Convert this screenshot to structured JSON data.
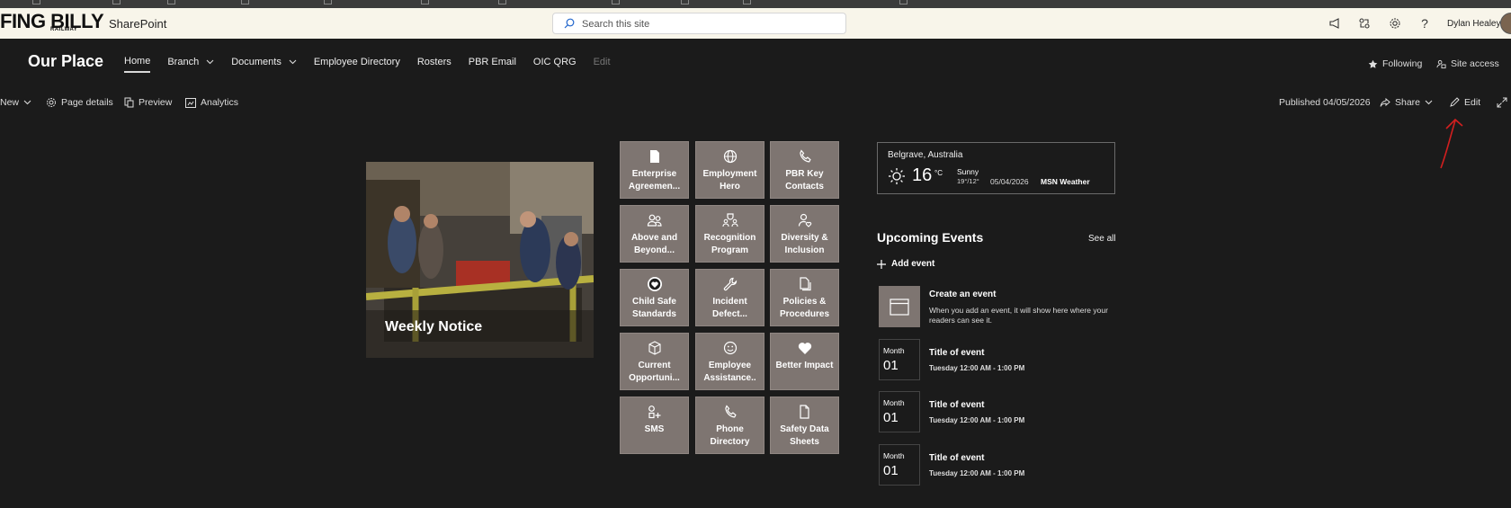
{
  "suitebar": {
    "logo_text": "FING BILLY",
    "logo_subtext": "RAILWAY",
    "app_name": "SharePoint",
    "search_placeholder": "Search this site",
    "icons": [
      "megaphone-icon",
      "share-app-icon",
      "settings-icon",
      "help-icon"
    ],
    "user_name": "Dylan Healey"
  },
  "site": {
    "title": "Our Place",
    "nav": [
      {
        "label": "Home",
        "active": true
      },
      {
        "label": "Branch",
        "dropdown": true
      },
      {
        "label": "Documents",
        "dropdown": true
      },
      {
        "label": "Employee Directory"
      },
      {
        "label": "Rosters"
      },
      {
        "label": "PBR Email"
      },
      {
        "label": "OIC QRG"
      },
      {
        "label": "Edit",
        "muted": true
      }
    ],
    "following_label": "Following",
    "site_access_label": "Site access"
  },
  "commandbar": {
    "new_label": "New",
    "page_details_label": "Page details",
    "preview_label": "Preview",
    "analytics_label": "Analytics",
    "published_label": "Published 04/05/2026",
    "share_label": "Share",
    "edit_label": "Edit"
  },
  "hero": {
    "title": "Weekly Notice"
  },
  "quick_links": [
    {
      "label": "Enterprise Agreemen...",
      "icon": "document-icon"
    },
    {
      "label": "Employment Hero",
      "icon": "globe-icon"
    },
    {
      "label": "PBR Key Contacts",
      "icon": "phone-icon"
    },
    {
      "label": "Above and Beyond...",
      "icon": "people-icon"
    },
    {
      "label": "Recognition Program",
      "icon": "trophy-people-icon"
    },
    {
      "label": "Diversity & Inclusion",
      "icon": "person-heart-icon"
    },
    {
      "label": "Child Safe Standards",
      "icon": "child-safe-badge-icon"
    },
    {
      "label": "Incident Defect...",
      "icon": "wrench-icon"
    },
    {
      "label": "Policies & Procedures",
      "icon": "documents-icon"
    },
    {
      "label": "Current Opportuni...",
      "icon": "cube-icon"
    },
    {
      "label": "Employee Assistance..",
      "icon": "smiley-icon"
    },
    {
      "label": "Better Impact",
      "icon": "heart-icon"
    },
    {
      "label": "SMS",
      "icon": "shapes-icon"
    },
    {
      "label": "Phone Directory",
      "icon": "phone-icon"
    },
    {
      "label": "Safety Data Sheets",
      "icon": "document-check-icon"
    }
  ],
  "weather": {
    "location": "Belgrave, Australia",
    "temperature": "16",
    "unit": "°C",
    "condition": "Sunny",
    "range": "19°/12°",
    "date": "05/04/2026",
    "source": "MSN Weather"
  },
  "events": {
    "heading": "Upcoming Events",
    "see_all": "See all",
    "add_label": "Add event",
    "create_title": "Create an event",
    "create_desc": "When you add an event, it will show here where your readers can see it.",
    "items": [
      {
        "month": "Month",
        "day": "01",
        "title": "Title of event",
        "time": "Tuesday 12:00 AM - 1:00 PM"
      },
      {
        "month": "Month",
        "day": "01",
        "title": "Title of event",
        "time": "Tuesday 12:00 AM - 1:00 PM"
      },
      {
        "month": "Month",
        "day": "01",
        "title": "Title of event",
        "time": "Tuesday 12:00 AM - 1:00 PM"
      }
    ]
  }
}
